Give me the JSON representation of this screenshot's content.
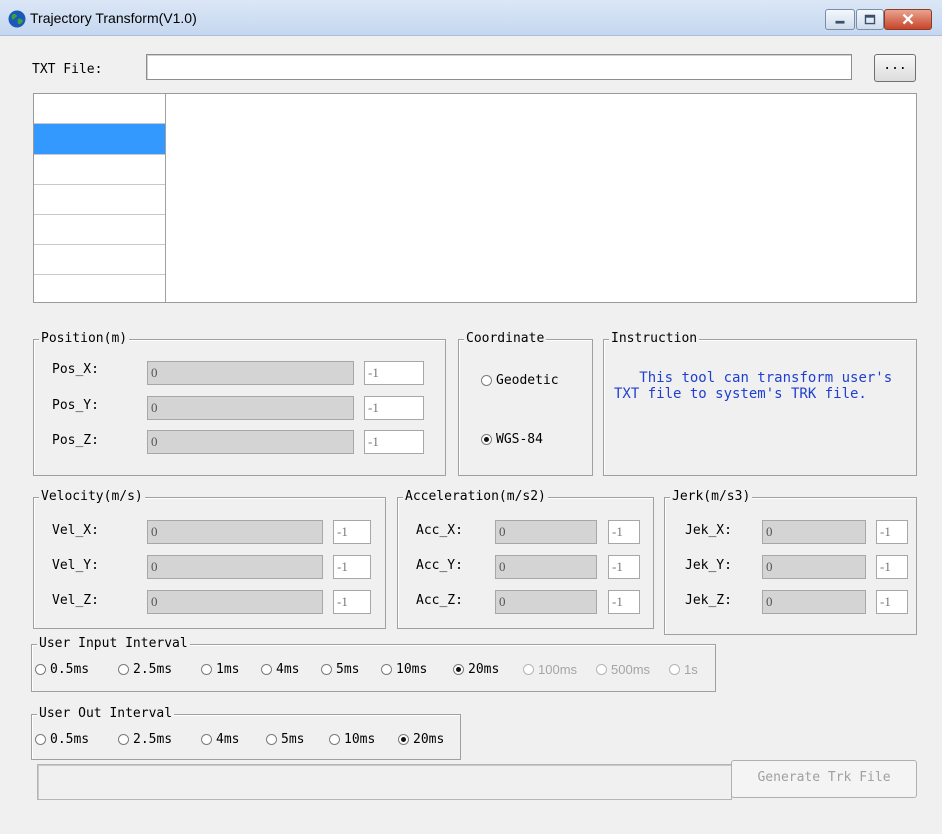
{
  "window": {
    "title": "Trajectory Transform(V1.0)"
  },
  "file": {
    "label": "TXT File:",
    "value": "",
    "browse_label": "..."
  },
  "position": {
    "title": "Position(m)",
    "rows": [
      {
        "label": "Pos_X:",
        "value": "0",
        "small": "-1"
      },
      {
        "label": "Pos_Y:",
        "value": "0",
        "small": "-1"
      },
      {
        "label": "Pos_Z:",
        "value": "0",
        "small": "-1"
      }
    ]
  },
  "coordinate": {
    "title": "Coordinate",
    "options": [
      {
        "label": "Geodetic",
        "selected": false
      },
      {
        "label": "WGS-84",
        "selected": true
      }
    ]
  },
  "instruction": {
    "title": "Instruction",
    "text": "   This tool can transform user's TXT file to system's TRK file."
  },
  "velocity": {
    "title": "Velocity(m/s)",
    "rows": [
      {
        "label": "Vel_X:",
        "value": "0",
        "small": "-1"
      },
      {
        "label": "Vel_Y:",
        "value": "0",
        "small": "-1"
      },
      {
        "label": "Vel_Z:",
        "value": "0",
        "small": "-1"
      }
    ]
  },
  "acceleration": {
    "title": "Acceleration(m/s2)",
    "rows": [
      {
        "label": "Acc_X:",
        "value": "0",
        "small": "-1"
      },
      {
        "label": "Acc_Y:",
        "value": "0",
        "small": "-1"
      },
      {
        "label": "Acc_Z:",
        "value": "0",
        "small": "-1"
      }
    ]
  },
  "jerk": {
    "title": "Jerk(m/s3)",
    "rows": [
      {
        "label": "Jek_X:",
        "value": "0",
        "small": "-1"
      },
      {
        "label": "Jek_Y:",
        "value": "0",
        "small": "-1"
      },
      {
        "label": "Jek_Z:",
        "value": "0",
        "small": "-1"
      }
    ]
  },
  "input_interval": {
    "title": "User Input Interval",
    "options": [
      {
        "label": "0.5ms",
        "selected": false,
        "disabled": false
      },
      {
        "label": "2.5ms",
        "selected": false,
        "disabled": false
      },
      {
        "label": "1ms",
        "selected": false,
        "disabled": false
      },
      {
        "label": "4ms",
        "selected": false,
        "disabled": false
      },
      {
        "label": "5ms",
        "selected": false,
        "disabled": false
      },
      {
        "label": "10ms",
        "selected": false,
        "disabled": false
      },
      {
        "label": "20ms",
        "selected": true,
        "disabled": false
      },
      {
        "label": "100ms",
        "selected": false,
        "disabled": true
      },
      {
        "label": "500ms",
        "selected": false,
        "disabled": true
      },
      {
        "label": "1s",
        "selected": false,
        "disabled": true
      }
    ]
  },
  "output_interval": {
    "title": "User Out Interval",
    "options": [
      {
        "label": "0.5ms",
        "selected": false
      },
      {
        "label": "2.5ms",
        "selected": false
      },
      {
        "label": "4ms",
        "selected": false
      },
      {
        "label": "5ms",
        "selected": false
      },
      {
        "label": "10ms",
        "selected": false
      },
      {
        "label": "20ms",
        "selected": true
      }
    ]
  },
  "actions": {
    "generate_label": "Generate Trk File"
  },
  "colors": {
    "selection": "#3399ff",
    "instruction_text": "#1f3fd0",
    "close_button": "#c8452b"
  },
  "icons": {
    "app": "globe-icon",
    "minimize": "minimize-icon",
    "maximize": "maximize-icon",
    "close": "close-icon"
  }
}
